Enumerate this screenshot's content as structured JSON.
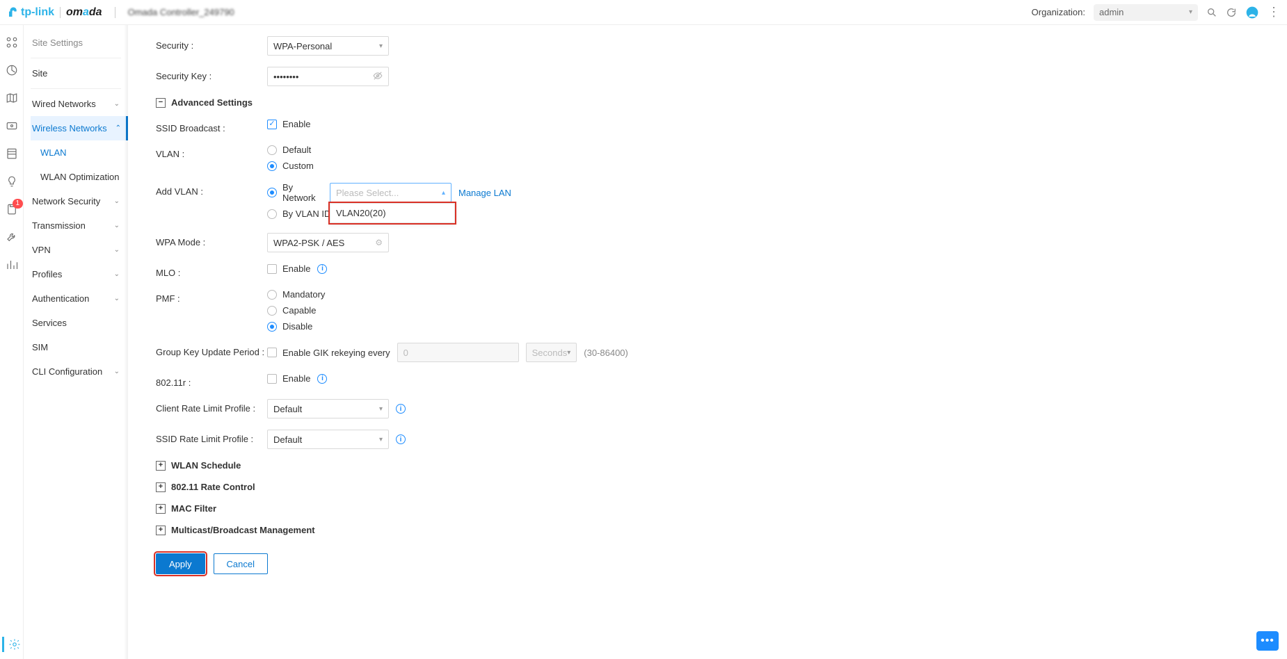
{
  "header": {
    "brand_tp": "tp-link",
    "brand_omada": "omada",
    "controller": "Omada Controller_249790",
    "org_label": "Organization:",
    "org_value": "admin"
  },
  "rail": {
    "badge": "1"
  },
  "sidebar": {
    "site_settings": "Site Settings",
    "site": "Site",
    "wired": "Wired Networks",
    "wireless": "Wireless Networks",
    "wlan": "WLAN",
    "wlan_opt": "WLAN Optimization",
    "netsec": "Network Security",
    "transmission": "Transmission",
    "vpn": "VPN",
    "profiles": "Profiles",
    "auth": "Authentication",
    "services": "Services",
    "sim": "SIM",
    "cli": "CLI Configuration"
  },
  "form": {
    "security_label": "Security :",
    "security_value": "WPA-Personal",
    "seckey_label": "Security Key :",
    "seckey_value": "••••••••",
    "advanced": "Advanced Settings",
    "ssid_broadcast_label": "SSID Broadcast :",
    "enable": "Enable",
    "vlan_label": "VLAN :",
    "vlan_default": "Default",
    "vlan_custom": "Custom",
    "add_vlan_label": "Add VLAN :",
    "by_network": "By Network",
    "by_vlan_id": "By VLAN ID",
    "please_select": "Please Select...",
    "manage_lan": "Manage LAN",
    "vlan_option": "VLAN20(20)",
    "wpa_mode_label": "WPA Mode :",
    "wpa_mode_value": "WPA2-PSK / AES",
    "mlo_label": "MLO :",
    "pmf_label": "PMF :",
    "pmf_mandatory": "Mandatory",
    "pmf_capable": "Capable",
    "pmf_disable": "Disable",
    "gkup_label": "Group Key Update Period :",
    "gkup_text": "Enable GIK rekeying every",
    "gkup_val": "0",
    "gkup_unit": "Seconds",
    "gkup_range": "(30-86400)",
    "r80211_label": "802.11r :",
    "crlp_label": "Client Rate Limit Profile :",
    "default_opt": "Default",
    "srlp_label": "SSID Rate Limit Profile :",
    "exp_wlan_schedule": "WLAN Schedule",
    "exp_rate_control": "802.11 Rate Control",
    "exp_mac_filter": "MAC Filter",
    "exp_multicast": "Multicast/Broadcast Management",
    "apply": "Apply",
    "cancel": "Cancel"
  }
}
